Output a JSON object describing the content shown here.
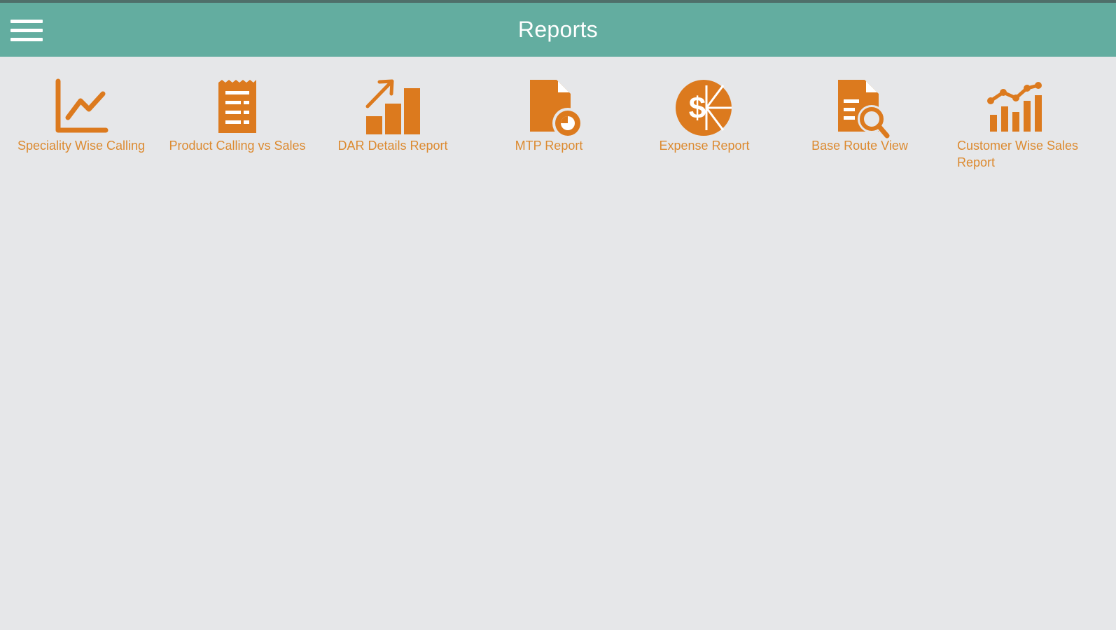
{
  "header": {
    "title": "Reports",
    "menu_icon": "hamburger-menu-icon"
  },
  "colors": {
    "appbar": "#63ada0",
    "accent": "#dc7a1e",
    "label": "#dc8a30",
    "background": "#e6e7e9"
  },
  "reports": [
    {
      "label": "Speciality Wise Calling",
      "icon": "line-chart-icon"
    },
    {
      "label": "Product Calling vs Sales",
      "icon": "receipt-document-icon"
    },
    {
      "label": "DAR Details Report",
      "icon": "growth-bar-chart-icon"
    },
    {
      "label": "MTP Report",
      "icon": "document-pie-chart-icon"
    },
    {
      "label": "Expense Report",
      "icon": "dollar-pie-icon"
    },
    {
      "label": "Base Route View",
      "icon": "document-search-icon"
    },
    {
      "label": "Customer Wise Sales Report",
      "icon": "trend-bar-chart-icon"
    }
  ]
}
